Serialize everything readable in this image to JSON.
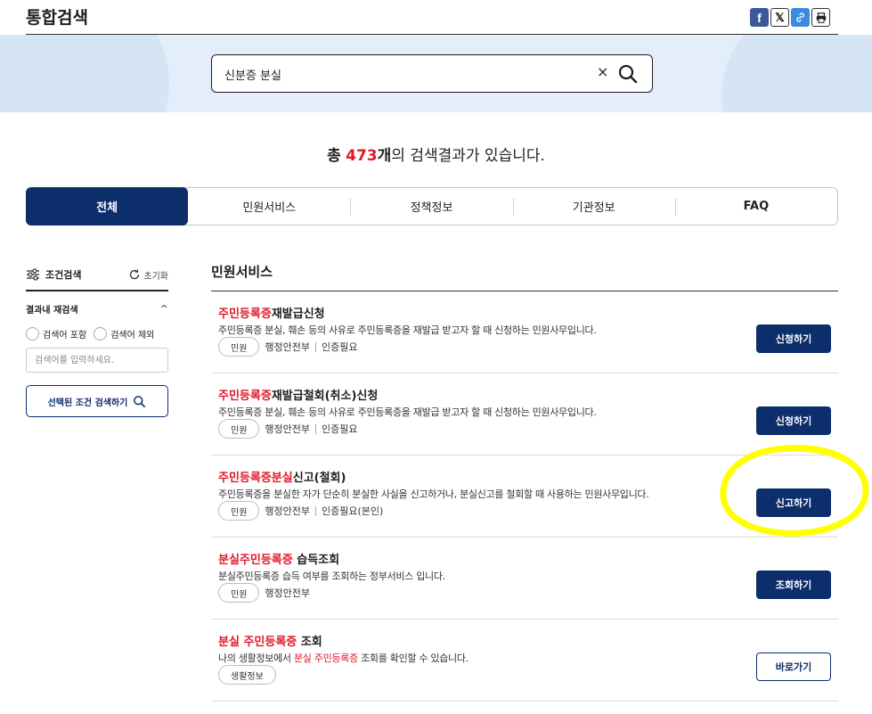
{
  "header": {
    "title": "통합검색"
  },
  "share": {
    "facebook_icon": "facebook-icon",
    "x_icon": "x-icon",
    "link_icon": "link-icon",
    "print_icon": "print-icon"
  },
  "search": {
    "value": "신분증 분실",
    "clear_label": "×"
  },
  "results": {
    "prefix": "총",
    "count": "473",
    "unit": "개",
    "suffix": "의 검색결과가 있습니다."
  },
  "tabs": [
    {
      "label": "전체"
    },
    {
      "label": "민원서비스"
    },
    {
      "label": "정책정보"
    },
    {
      "label": "기관정보"
    },
    {
      "label": "FAQ"
    }
  ],
  "sidebar": {
    "filter_label": "조건검색",
    "reset_label": "초기화",
    "refine_label": "결과내 재검색",
    "include_label": "검색어 포함",
    "exclude_label": "검색어 제외",
    "input_placeholder": "검색어를 입력하세요.",
    "search_button": "선택된 조건 검색하기"
  },
  "main": {
    "section_title": "민원서비스",
    "items": [
      {
        "title_hl": "주민등록증",
        "title_rest": "재발급신청",
        "desc": "주민등록증 분실, 훼손 등의 사유로 주민등록증을 재발급 받고자 할 때 신청하는 민원사무입니다.",
        "chip": "민원",
        "agency": "행정안전부",
        "auth": "인증필요",
        "action": "신청하기"
      },
      {
        "title_hl": "주민등록증",
        "title_rest": "재발급철회(취소)신청",
        "desc": "주민등록증 분실, 훼손 등의 사유로 주민등록증을 재발급 받고자 할 때 신청하는 민원사무입니다.",
        "chip": "민원",
        "agency": "행정안전부",
        "auth": "인증필요",
        "action": "신청하기"
      },
      {
        "title_hl": "주민등록증분실",
        "title_rest": "신고(철회)",
        "desc": "주민등록증을 분실한 자가 단순히 분실한 사실을 신고하거나, 분실신고를 철회할 때 사용하는 민원사무입니다.",
        "chip": "민원",
        "agency": "행정안전부",
        "auth": "인증필요(본인)",
        "action": "신고하기"
      },
      {
        "title_hl": "분실주민등록증",
        "title_rest": " 습득조회",
        "desc": "분실주민등록증 습득 여부를 조회하는 정부서비스 입니다.",
        "chip": "민원",
        "agency": "행정안전부",
        "action": "조회하기"
      },
      {
        "title_hl": "분실 주민등록증",
        "title_rest": " 조회",
        "desc_pre": "나의 생활정보에서 ",
        "desc_hl": "분실 주민등록증",
        "desc_post": " 조회를 확인할 수 있습니다.",
        "chip": "생활정보",
        "action": "바로가기"
      }
    ]
  },
  "colors": {
    "navy": "#0c2e6b",
    "highlight_red": "#e0192a",
    "hero_bg": "#e3eefa",
    "annotation_yellow": "#ffff00"
  }
}
